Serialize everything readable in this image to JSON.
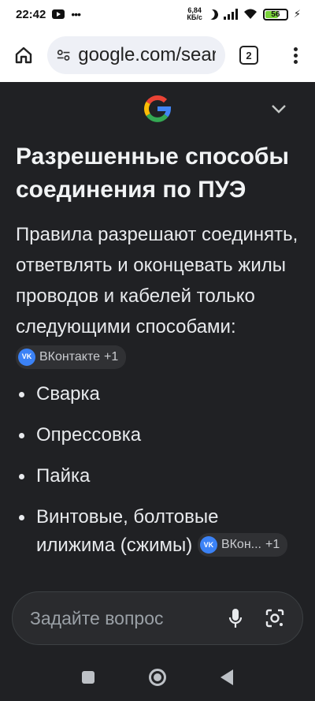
{
  "status_bar": {
    "time": "22:42",
    "net_speed_value": "6,84",
    "net_speed_unit": "КБ/с",
    "battery": "56",
    "icons": [
      "youtube-icon",
      "more-dots-icon",
      "moon-icon",
      "signal-icon",
      "wifi-icon",
      "battery-icon",
      "charging-bolt-icon"
    ]
  },
  "toolbar": {
    "url": "google.com/search",
    "tab_count": "2"
  },
  "content": {
    "title": "Разрешенные способы соединения по ПУЭ",
    "paragraph": "Правила разрешают соединять, ответвлять и оконцевать жилы проводов и кабелей только следующими способами:",
    "paragraph_source": {
      "name": "ВКонтакте",
      "more": "+1"
    },
    "bullets": [
      "Сварка",
      "Опрессовка",
      "Пайка",
      "Винтовые, болтовые илижима (сжимы)"
    ],
    "bullet_source": {
      "name": "ВКон...",
      "more": "+1"
    },
    "colors": {
      "background": "#202124",
      "text": "#e8eaed",
      "chip": "#303134",
      "vk": "#3b82f6"
    }
  },
  "ask": {
    "placeholder": "Задайте вопрос"
  }
}
